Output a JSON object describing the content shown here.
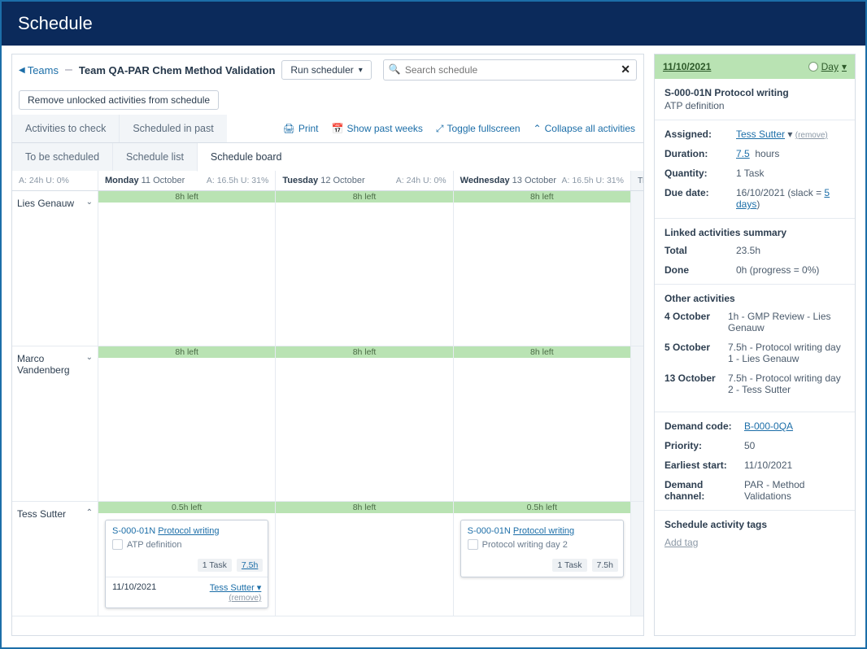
{
  "header": {
    "title": "Schedule"
  },
  "toolbar": {
    "teams_link": "Teams",
    "team_name": "Team QA-PAR Chem Method Validation",
    "run_scheduler": "Run scheduler",
    "search_placeholder": "Search schedule",
    "remove_unlocked": "Remove unlocked activities from schedule"
  },
  "tabs": {
    "row1": [
      "Activities to check",
      "Scheduled in past"
    ],
    "row2": [
      "To be scheduled",
      "Schedule list",
      "Schedule board"
    ],
    "active": "Schedule board"
  },
  "actions": {
    "print": "Print",
    "show_past": "Show past weeks",
    "toggle_fs": "Toggle fullscreen",
    "collapse": "Collapse all activities"
  },
  "board": {
    "sidebar_stat": "A: 24h   U: 0%",
    "days": [
      {
        "label_day": "Monday",
        "label_date": "11 October",
        "stat": "A: 16.5h   U: 31%"
      },
      {
        "label_day": "Tuesday",
        "label_date": "12 October",
        "stat": "A: 24h   U: 0%"
      },
      {
        "label_day": "Wednesday",
        "label_date": "13 October",
        "stat": "A: 16.5h   U: 31%"
      }
    ],
    "th_label": "Th",
    "people": [
      {
        "name": "Lies Genauw",
        "collapsed": true,
        "cells": [
          {
            "bar": "8h left"
          },
          {
            "bar": "8h left"
          },
          {
            "bar": "8h left"
          }
        ]
      },
      {
        "name": "Marco Vandenberg",
        "collapsed": true,
        "cells": [
          {
            "bar": "8h left"
          },
          {
            "bar": "8h left"
          },
          {
            "bar": "8h left"
          }
        ]
      },
      {
        "name": "Tess Sutter",
        "collapsed": false,
        "cells": [
          {
            "bar": "0.5h left",
            "card": {
              "code": "S-000-01N",
              "title": "Protocol writing",
              "sub": "ATP definition",
              "badges": [
                "1 Task",
                "7.5h"
              ],
              "footer_date": "11/10/2021",
              "footer_assignee": "Tess Sutter",
              "footer_remove": "(remove)"
            }
          },
          {
            "bar": "8h left"
          },
          {
            "bar": "0.5h left",
            "card": {
              "code": "S-000-01N",
              "title": "Protocol writing",
              "sub": "Protocol writing day 2",
              "badges": [
                "1 Task",
                "7.5h"
              ]
            }
          }
        ]
      }
    ]
  },
  "panel": {
    "date": "11/10/2021",
    "mode": "Day",
    "heading": "S-000-01N Protocol writing",
    "sub": "ATP definition",
    "props": {
      "assigned_label": "Assigned:",
      "assigned_value": "Tess Sutter",
      "assigned_remove": "(remove)",
      "duration_label": "Duration:",
      "duration_value": "7.5",
      "duration_unit": "hours",
      "quantity_label": "Quantity:",
      "quantity_value": "1 Task",
      "due_label": "Due date:",
      "due_value": "16/10/2021 (slack = ",
      "due_link": "5 days",
      "due_tail": ")"
    },
    "linked": {
      "heading": "Linked activities summary",
      "total_label": "Total",
      "total_value": "23.5h",
      "done_label": "Done",
      "done_value": "0h (progress = 0%)"
    },
    "other": {
      "heading": "Other activities",
      "items": [
        {
          "d": "4 October",
          "t": "1h - GMP Review - Lies Genauw"
        },
        {
          "d": "5 October",
          "t": "7.5h - Protocol writing day 1 - Lies Genauw"
        },
        {
          "d": "13 October",
          "t": "7.5h - Protocol writing day 2 - Tess Sutter"
        }
      ]
    },
    "demand": {
      "code_label": "Demand code:",
      "code_value": "B-000-0QA",
      "priority_label": "Priority:",
      "priority_value": "50",
      "earliest_label": "Earliest start:",
      "earliest_value": "11/10/2021",
      "channel_label": "Demand channel:",
      "channel_value": "PAR - Method Validations"
    },
    "tags": {
      "heading": "Schedule activity tags",
      "add": "Add tag"
    }
  }
}
